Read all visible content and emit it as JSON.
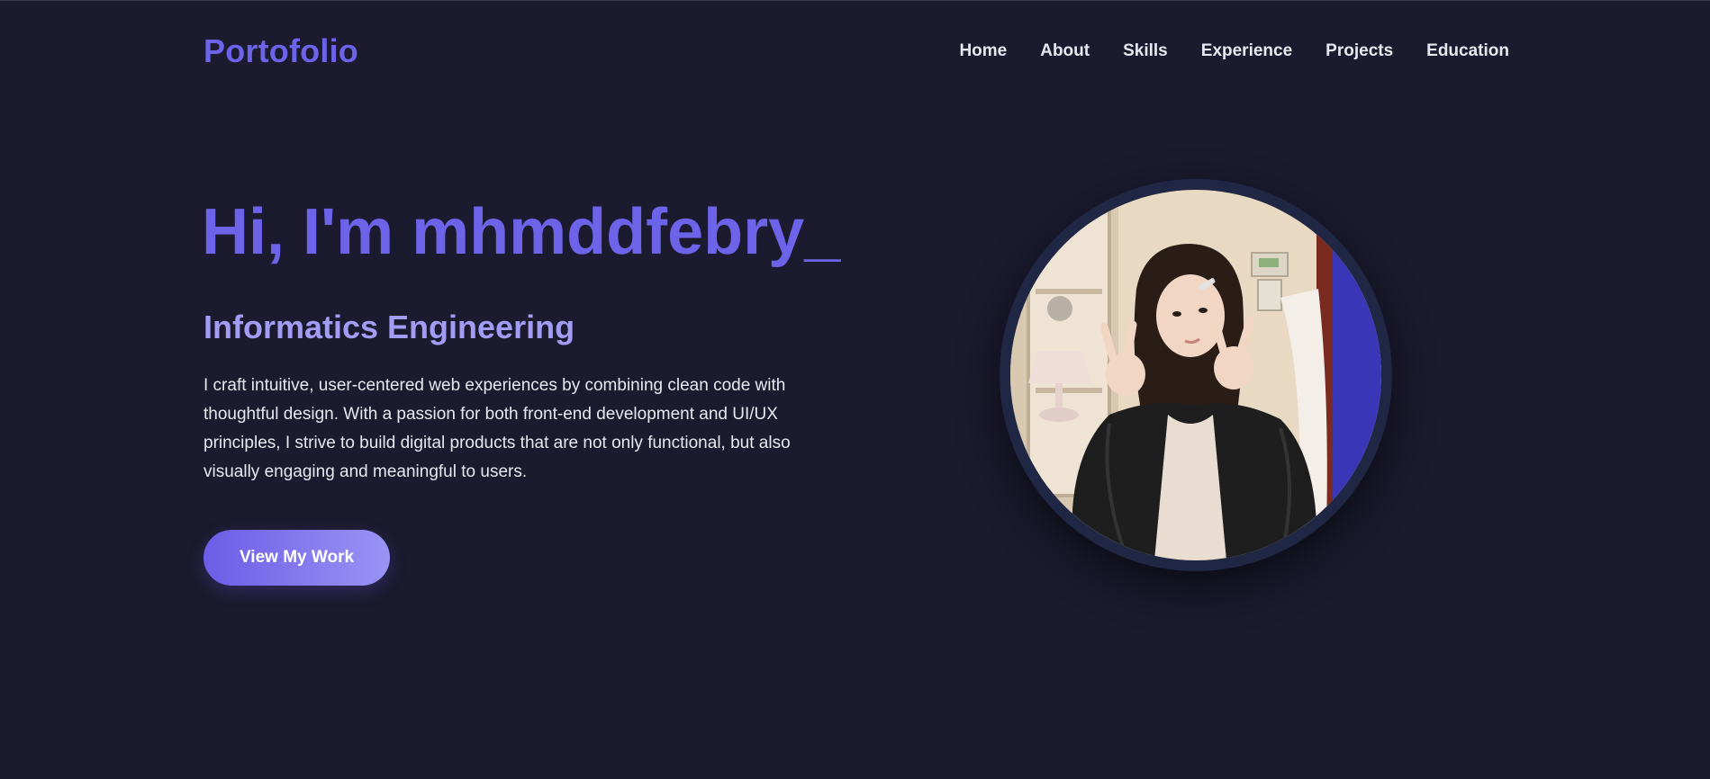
{
  "header": {
    "logo": "Portofolio",
    "nav": [
      {
        "label": "Home"
      },
      {
        "label": "About"
      },
      {
        "label": "Skills"
      },
      {
        "label": "Experience"
      },
      {
        "label": "Projects"
      },
      {
        "label": "Education"
      }
    ]
  },
  "hero": {
    "title": "Hi, I'm mhmddfebry",
    "cursor": "_",
    "subtitle": "Informatics Engineering",
    "bio": "I craft intuitive, user-centered web experiences by combining clean code with thoughtful design. With a passion for both front-end development and UI/UX principles, I strive to build digital products that are not only functional, but also visually engaging and meaningful to users.",
    "cta_label": "View My Work"
  },
  "colors": {
    "background": "#1b1a2e",
    "accent": "#6c63e8",
    "accent_light": "#a39cf5",
    "text": "#e8e8f0"
  }
}
